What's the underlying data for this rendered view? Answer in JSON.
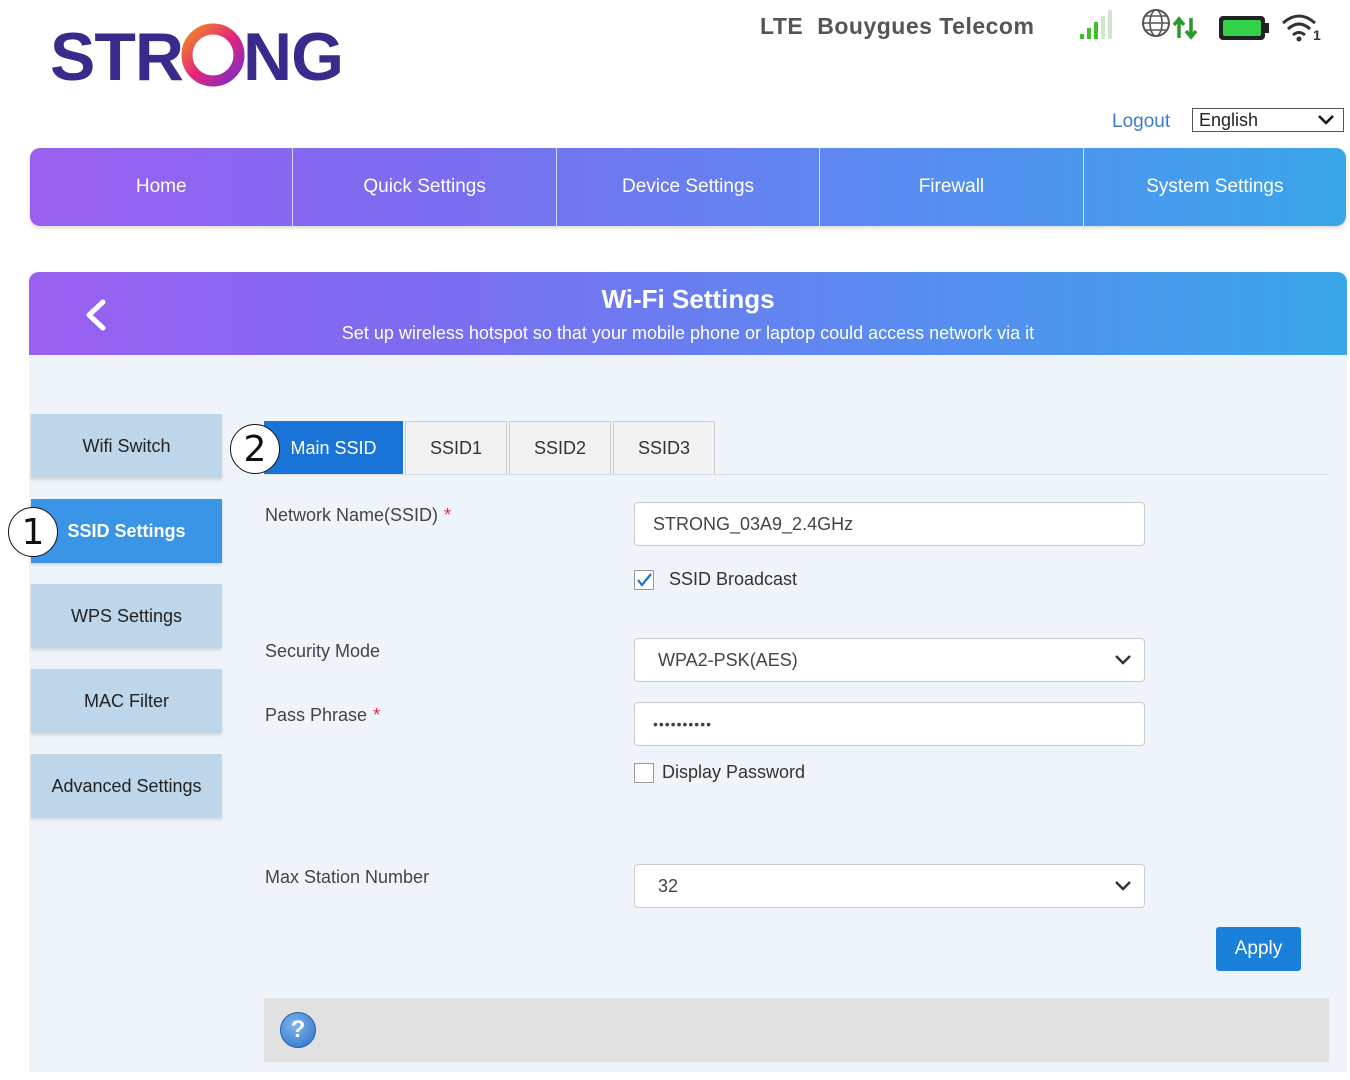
{
  "brand": {
    "logo_text": "STRONG"
  },
  "status": {
    "network_type": "LTE",
    "carrier": "Bouygues Telecom",
    "wifi_clients": "1",
    "icons": [
      "signal-bars-icon",
      "globe-data-icon",
      "battery-icon",
      "wifi-icon"
    ]
  },
  "header": {
    "logout": "Logout",
    "language": "English"
  },
  "nav": [
    "Home",
    "Quick Settings",
    "Device Settings",
    "Firewall",
    "System Settings"
  ],
  "page": {
    "title": "Wi-Fi Settings",
    "subtitle": "Set up wireless hotspot so that your mobile phone or laptop could access network via it"
  },
  "sidebar": [
    "Wifi Switch",
    "SSID Settings",
    "WPS Settings",
    "MAC Filter",
    "Advanced Settings"
  ],
  "sidebar_active": "SSID Settings",
  "tabs": [
    "Main SSID",
    "SSID1",
    "SSID2",
    "SSID3"
  ],
  "tab_active": "Main SSID",
  "form": {
    "ssid_label": "Network Name(SSID)",
    "ssid_value": "STRONG_03A9_2.4GHz",
    "broadcast_label": "SSID Broadcast",
    "broadcast_checked": true,
    "security_label": "Security Mode",
    "security_value": "WPA2-PSK(AES)",
    "pass_label": "Pass Phrase",
    "pass_value": "••••••••••",
    "display_pw_label": "Display Password",
    "display_pw_checked": false,
    "max_station_label": "Max Station Number",
    "max_station_value": "32",
    "required_mark": "*",
    "apply": "Apply"
  },
  "help_icon": "?",
  "callouts": [
    "1",
    "2"
  ],
  "colors": {
    "accent": "#1a73d6",
    "nav_start": "#9b5ff0",
    "nav_end": "#3aa6ea",
    "sidebar_bg": "#bdd6ea"
  }
}
